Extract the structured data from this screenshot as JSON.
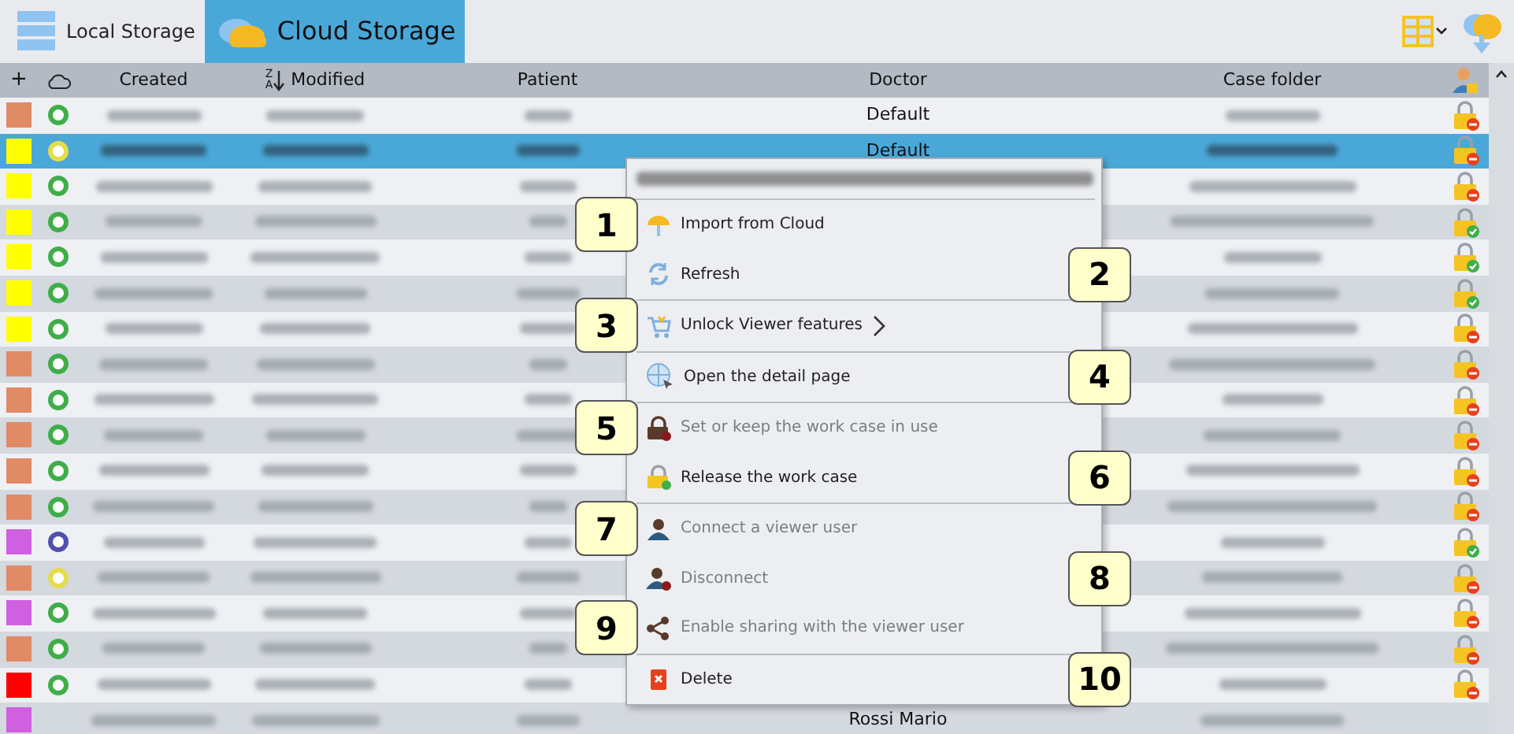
{
  "tabs": [
    {
      "label": "Local Storage",
      "selected": false
    },
    {
      "label": "Cloud Storage",
      "selected": true
    }
  ],
  "table": {
    "columns": [
      "+",
      "Created",
      "Modified",
      "Patient",
      "Doctor",
      "Case folder"
    ],
    "sort_indicator": {
      "top": "Z",
      "bottom": "A"
    },
    "rows": [
      {
        "swatch": {
          "color": "#e08a66"
        },
        "status": {
          "color": "#3fae49"
        },
        "doctor": "Default",
        "released": false,
        "selected": false
      },
      {
        "swatch": {
          "color": "#ffff00"
        },
        "status": {
          "color": "#e6dc4a"
        },
        "doctor": "Default",
        "released": false,
        "selected": true
      },
      {
        "swatch": {
          "color": "#ffff00"
        },
        "status": {
          "color": "#3fae49"
        },
        "released": false,
        "selected": false
      },
      {
        "swatch": {
          "color": "#ffff00"
        },
        "status": {
          "color": "#3fae49"
        },
        "released": true,
        "selected": false
      },
      {
        "swatch": {
          "color": "#ffff00"
        },
        "status": {
          "color": "#3fae49"
        },
        "released": true,
        "selected": false
      },
      {
        "swatch": {
          "color": "#ffff00"
        },
        "status": {
          "color": "#3fae49"
        },
        "released": true,
        "selected": false
      },
      {
        "swatch": {
          "color": "#ffff00"
        },
        "status": {
          "color": "#3fae49"
        },
        "released": false,
        "selected": false
      },
      {
        "swatch": {
          "color": "#e08a66"
        },
        "status": {
          "color": "#3fae49"
        },
        "released": false,
        "selected": false
      },
      {
        "swatch": {
          "color": "#e08a66"
        },
        "status": {
          "color": "#3fae49"
        },
        "released": false,
        "selected": false
      },
      {
        "swatch": {
          "color": "#e08a66"
        },
        "status": {
          "color": "#3fae49"
        },
        "released": false,
        "selected": false
      },
      {
        "swatch": {
          "color": "#e08a66"
        },
        "status": {
          "color": "#3fae49"
        },
        "released": false,
        "selected": false
      },
      {
        "swatch": {
          "color": "#e08a66"
        },
        "status": {
          "color": "#3fae49"
        },
        "released": false,
        "selected": false
      },
      {
        "swatch": {
          "color": "#d060e0"
        },
        "status": {
          "color": "#5050b0"
        },
        "released": true,
        "selected": false
      },
      {
        "swatch": {
          "color": "#e08a66"
        },
        "status": {
          "color": "#e6dc4a"
        },
        "released": false,
        "selected": false
      },
      {
        "swatch": {
          "color": "#d060e0"
        },
        "status": {
          "color": "#3fae49"
        },
        "released": false,
        "selected": false
      },
      {
        "swatch": {
          "color": "#e08a66"
        },
        "status": {
          "color": "#3fae49"
        },
        "released": false,
        "selected": false
      },
      {
        "swatch": {
          "color": "#ff0000"
        },
        "status": {
          "color": "#3fae49"
        },
        "released": false,
        "selected": false
      },
      {
        "swatch": {
          "color": "#d060e0"
        },
        "doctor": "Rossi Mario",
        "selected": false
      }
    ]
  },
  "context_menu": {
    "items": [
      {
        "label": "Import from Cloud",
        "disabled": false,
        "callout": "1"
      },
      {
        "label": "Refresh",
        "disabled": false,
        "separator_after": true,
        "callout": "2"
      },
      {
        "label": "Unlock Viewer features",
        "disabled": false,
        "submenu": true,
        "separator_after": true,
        "callout": "3"
      },
      {
        "label": "Open the detail page",
        "disabled": false,
        "separator_after": true,
        "callout": "4"
      },
      {
        "label": "Set or keep the work case in use",
        "disabled": true,
        "callout": "5"
      },
      {
        "label": "Release the work case",
        "disabled": false,
        "separator_after": true,
        "callout": "6"
      },
      {
        "label": "Connect a viewer user",
        "disabled": true,
        "callout": "7"
      },
      {
        "label": "Disconnect",
        "disabled": true,
        "callout": "8"
      },
      {
        "label": "Enable sharing with the viewer user",
        "disabled": true,
        "separator_after": true,
        "callout": "9"
      },
      {
        "label": "Delete",
        "disabled": false,
        "callout": "10"
      }
    ]
  }
}
